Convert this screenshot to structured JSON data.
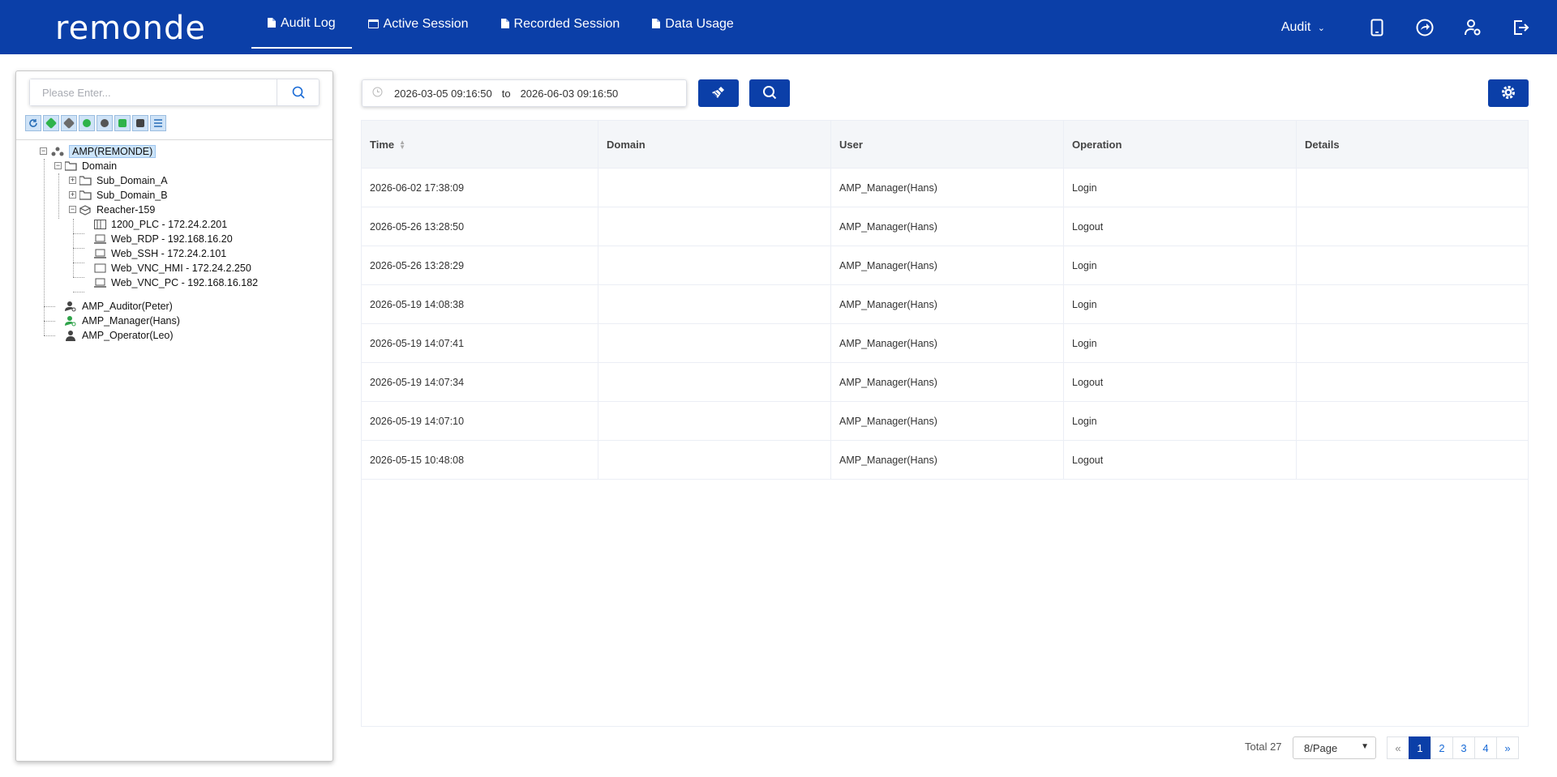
{
  "header": {
    "logo": "remonde",
    "nav": [
      {
        "label": "Audit Log",
        "active": true,
        "icon": "document-icon"
      },
      {
        "label": "Active Session",
        "active": false,
        "icon": "window-icon"
      },
      {
        "label": "Recorded Session",
        "active": false,
        "icon": "document-icon"
      },
      {
        "label": "Data Usage",
        "active": false,
        "icon": "document-icon"
      }
    ],
    "role_dropdown": "Audit",
    "right_icons": [
      "mobile-icon",
      "share-arrow-icon",
      "user-settings-icon",
      "logout-icon"
    ],
    "bg_color": "#0b3fa8"
  },
  "sidebar": {
    "search_placeholder": "Please Enter...",
    "toolbar_icons": [
      "refresh-icon",
      "add-domain-icon",
      "add-reacher-icon",
      "add-device-icon",
      "device-settings-icon",
      "add-group-icon",
      "users-icon",
      "list-icon"
    ],
    "tree": [
      {
        "label": "AMP(REMONDE)",
        "icon": "organization-icon",
        "selected": true
      },
      {
        "label": "Domain",
        "icon": "folder-open-icon"
      },
      {
        "label": "Sub_Domain_A",
        "icon": "folder-icon"
      },
      {
        "label": "Sub_Domain_B",
        "icon": "folder-icon"
      },
      {
        "label": "Reacher-159",
        "icon": "cube-icon"
      },
      {
        "label": "1200_PLC - 172.24.2.201",
        "icon": "plc-icon"
      },
      {
        "label": "Web_RDP - 192.168.16.20",
        "icon": "laptop-icon"
      },
      {
        "label": "Web_SSH - 172.24.2.101",
        "icon": "laptop-icon"
      },
      {
        "label": "Web_VNC_HMI - 172.24.2.250",
        "icon": "monitor-icon"
      },
      {
        "label": "Web_VNC_PC - 192.168.16.182",
        "icon": "laptop-icon"
      },
      {
        "label": "AMP_Auditor(Peter)",
        "icon": "auditor-user-icon"
      },
      {
        "label": "AMP_Manager(Hans)",
        "icon": "manager-user-icon"
      },
      {
        "label": "AMP_Operator(Leo)",
        "icon": "operator-user-icon"
      }
    ]
  },
  "filter": {
    "date_from": "2026-03-05 09:16:50",
    "date_to": "2026-06-03 09:16:50",
    "to_label": "to"
  },
  "table": {
    "columns": [
      "Time",
      "Domain",
      "User",
      "Operation",
      "Details"
    ],
    "rows": [
      {
        "time": "2026-06-02 17:38:09",
        "domain": "",
        "user": "AMP_Manager(Hans)",
        "operation": "Login",
        "details": ""
      },
      {
        "time": "2026-05-26 13:28:50",
        "domain": "",
        "user": "AMP_Manager(Hans)",
        "operation": "Logout",
        "details": ""
      },
      {
        "time": "2026-05-26 13:28:29",
        "domain": "",
        "user": "AMP_Manager(Hans)",
        "operation": "Login",
        "details": ""
      },
      {
        "time": "2026-05-19 14:08:38",
        "domain": "",
        "user": "AMP_Manager(Hans)",
        "operation": "Login",
        "details": ""
      },
      {
        "time": "2026-05-19 14:07:41",
        "domain": "",
        "user": "AMP_Manager(Hans)",
        "operation": "Login",
        "details": ""
      },
      {
        "time": "2026-05-19 14:07:34",
        "domain": "",
        "user": "AMP_Manager(Hans)",
        "operation": "Logout",
        "details": ""
      },
      {
        "time": "2026-05-19 14:07:10",
        "domain": "",
        "user": "AMP_Manager(Hans)",
        "operation": "Login",
        "details": ""
      },
      {
        "time": "2026-05-15 10:48:08",
        "domain": "",
        "user": "AMP_Manager(Hans)",
        "operation": "Logout",
        "details": ""
      }
    ]
  },
  "pagination": {
    "total_label": "Total 27",
    "page_size": "8/Page",
    "prev": "«",
    "next": "»",
    "pages": [
      "1",
      "2",
      "3",
      "4"
    ],
    "current": "1"
  }
}
